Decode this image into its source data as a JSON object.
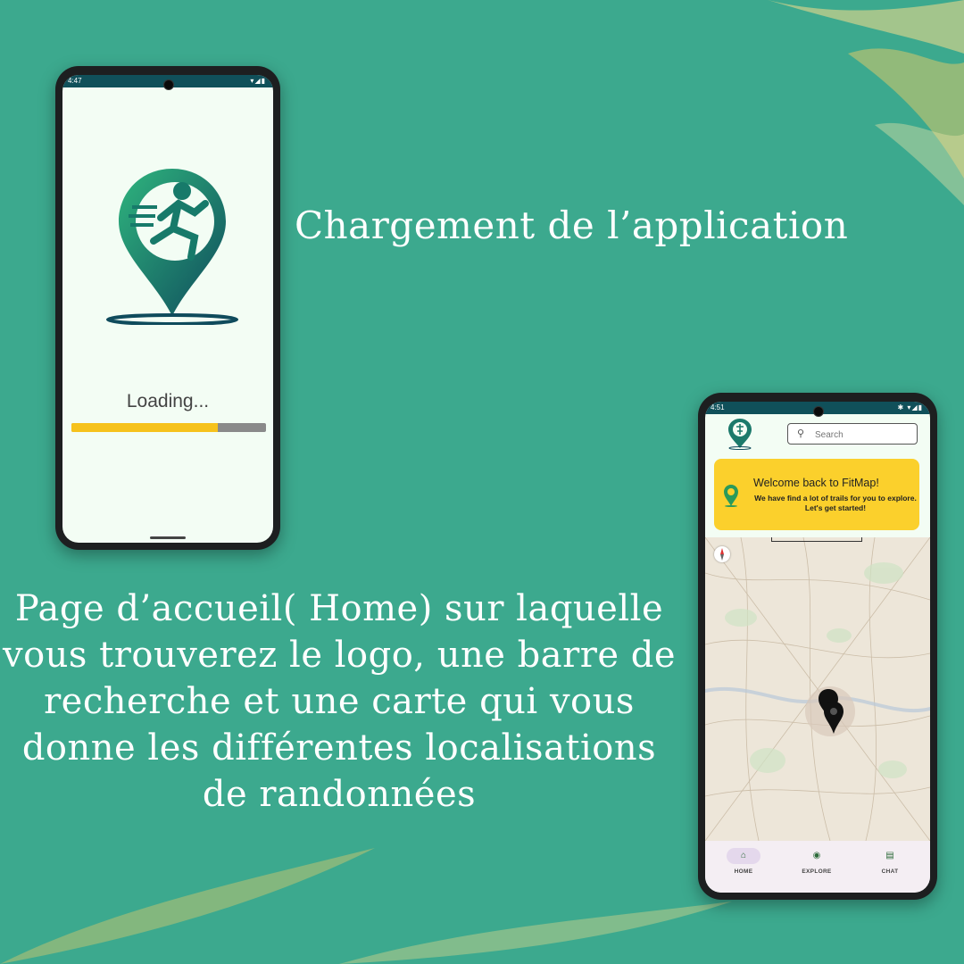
{
  "captions": {
    "loading": "Chargement de l’application",
    "home": "Page d’accueil( Home) sur laquelle vous trouverez le logo, une barre de recherche et une carte qui vous donne les différentes localisations de randonnées"
  },
  "colors": {
    "background": "#3ca98e",
    "accent_yellow": "#fbd02c",
    "progress_fill": "#f6c21c",
    "status_bar": "#10505a"
  },
  "phone_loading": {
    "status_time": "4:47",
    "status_icons": "▾◢▮",
    "loading_text": "Loading...",
    "progress_fraction": 0.75
  },
  "phone_home": {
    "status_time": "4:51",
    "status_icons": "✱ ▾◢▮",
    "search": {
      "placeholder": "Search",
      "icon": "search-icon"
    },
    "welcome": {
      "title": "Welcome back to FitMap!",
      "subtitle": "We have find a lot of trails for you to explore. Let's get started!"
    },
    "nav": [
      {
        "label": "HOME",
        "icon": "home-icon",
        "active": true
      },
      {
        "label": "EXPLORE",
        "icon": "explore-icon",
        "active": false
      },
      {
        "label": "CHAT",
        "icon": "chat-icon",
        "active": false
      }
    ]
  }
}
